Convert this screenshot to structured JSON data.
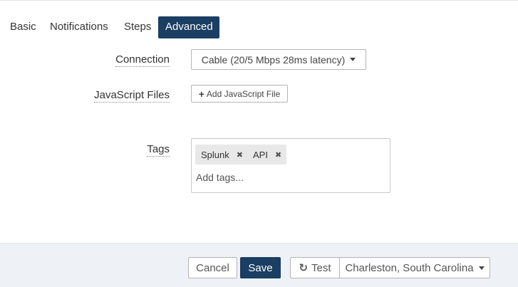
{
  "tabs": [
    {
      "label": "Basic"
    },
    {
      "label": "Notifications"
    },
    {
      "label": "Steps"
    },
    {
      "label": "Advanced"
    }
  ],
  "active_tab": "Advanced",
  "connection": {
    "label": "Connection",
    "selected": "Cable (20/5 Mbps 28ms latency)"
  },
  "javascript": {
    "label": "JavaScript Files",
    "add_button": "Add JavaScript File",
    "add_icon": "+"
  },
  "tags": {
    "label": "Tags",
    "items": [
      {
        "text": "Splunk",
        "remove": "✖"
      },
      {
        "text": "API",
        "remove": "✖"
      }
    ],
    "placeholder": "Add tags..."
  },
  "footer": {
    "cancel": "Cancel",
    "save": "Save",
    "test": "Test",
    "test_icon": "↻",
    "location": "Charleston, South Carolina"
  },
  "colors": {
    "primary": "#1b3e63",
    "footer_bg": "#eef1f5"
  }
}
